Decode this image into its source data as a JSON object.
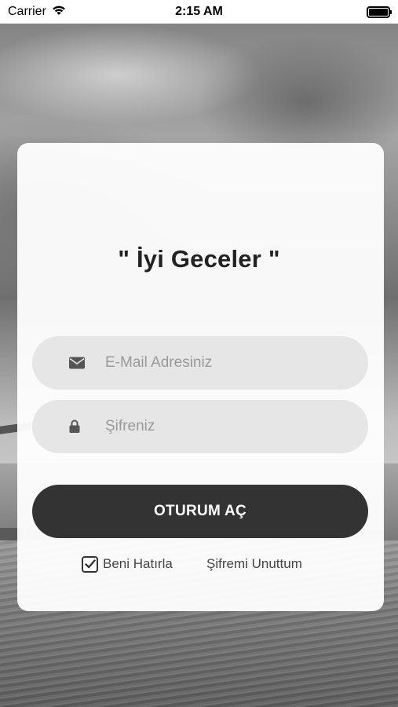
{
  "status_bar": {
    "carrier": "Carrier",
    "time": "2:15 AM"
  },
  "login": {
    "greeting": "\" İyi Geceler \"",
    "email_placeholder": "E-Mail Adresiniz",
    "email_value": "",
    "password_placeholder": "Şifreniz",
    "password_value": "",
    "submit_label": "OTURUM AÇ",
    "remember_label": "Beni Hatırla",
    "remember_checked": true,
    "forgot_label": "Şifremi Unuttum"
  },
  "icons": {
    "email": "envelope-icon",
    "password": "lock-icon",
    "wifi": "wifi-icon",
    "battery": "battery-icon"
  },
  "colors": {
    "button": "#333333",
    "field": "#e6e6e6",
    "card": "#ffffff"
  }
}
